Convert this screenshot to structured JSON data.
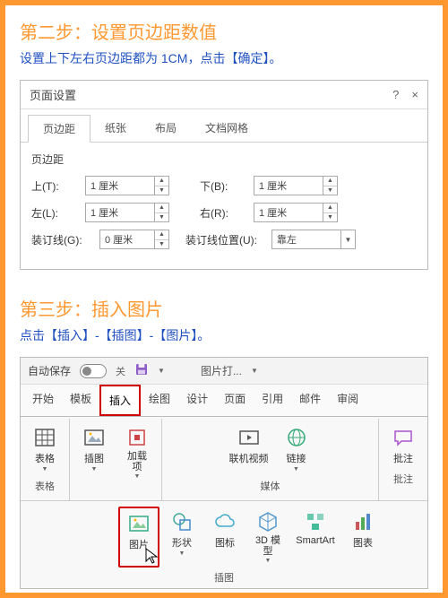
{
  "step2": {
    "title": "第二步：设置页边距数值",
    "desc": "设置上下左右页边距都为 1CM，点击【确定】。"
  },
  "dialog": {
    "title": "页面设置",
    "help": "?",
    "close": "×",
    "tabs": [
      "页边距",
      "纸张",
      "布局",
      "文档网格"
    ],
    "section": "页边距",
    "top_label": "上(T):",
    "top_value": "1 厘米",
    "bottom_label": "下(B):",
    "bottom_value": "1 厘米",
    "left_label": "左(L):",
    "left_value": "1 厘米",
    "right_label": "右(R):",
    "right_value": "1 厘米",
    "gutter_label": "装订线(G):",
    "gutter_value": "0 厘米",
    "gutter_pos_label": "装订线位置(U):",
    "gutter_pos_value": "靠左"
  },
  "step3": {
    "title": "第三步：插入图片",
    "desc": "点击【插入】-【插图】-【图片】。"
  },
  "ribbon": {
    "autosave": "自动保存",
    "autosave_state": "关",
    "doctitle": "图片打...",
    "tabs": [
      "开始",
      "模板",
      "插入",
      "绘图",
      "设计",
      "页面",
      "引用",
      "邮件",
      "审阅"
    ],
    "groups": {
      "tables": {
        "btn": "表格",
        "name": "表格"
      },
      "illust": {
        "btn": "插图",
        "addin": "加载\n项"
      },
      "media": {
        "video": "联机视频",
        "link": "链接",
        "name": "媒体"
      },
      "comment": {
        "btn": "批注",
        "name": "批注"
      }
    },
    "sub": {
      "picture": "图片",
      "shapes": "形状",
      "icons": "图标",
      "model3d": "3D 模\n型",
      "smartart": "SmartArt",
      "chart": "图表",
      "name": "插图"
    }
  }
}
